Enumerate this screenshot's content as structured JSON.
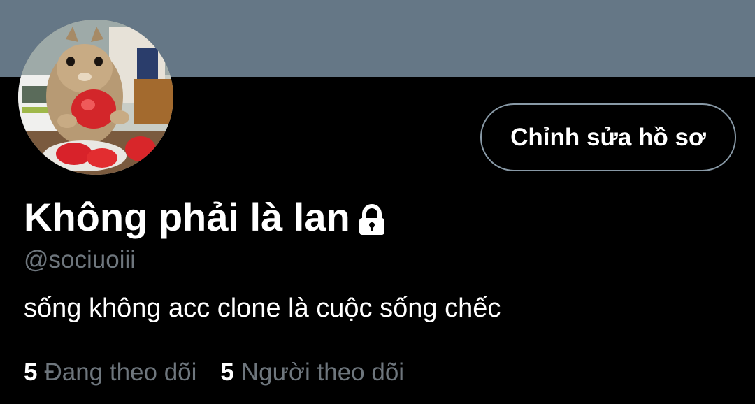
{
  "colors": {
    "banner": "#657786",
    "background": "#000000",
    "primary_text": "#ffffff",
    "secondary_text": "#6e767d",
    "button_border": "#8899a6"
  },
  "profile": {
    "avatar_icon": "chipmunk-with-strawberry-photo",
    "display_name": "Không phải là lan",
    "protected_icon": "lock-icon",
    "handle": "@sociuoiii",
    "bio": "sống không acc clone là cuộc sống chếc",
    "edit_button_label": "Chỉnh sửa hồ sơ"
  },
  "stats": {
    "following_count": "5",
    "following_label": "Đang theo dõi",
    "followers_count": "5",
    "followers_label": "Người theo dõi"
  }
}
